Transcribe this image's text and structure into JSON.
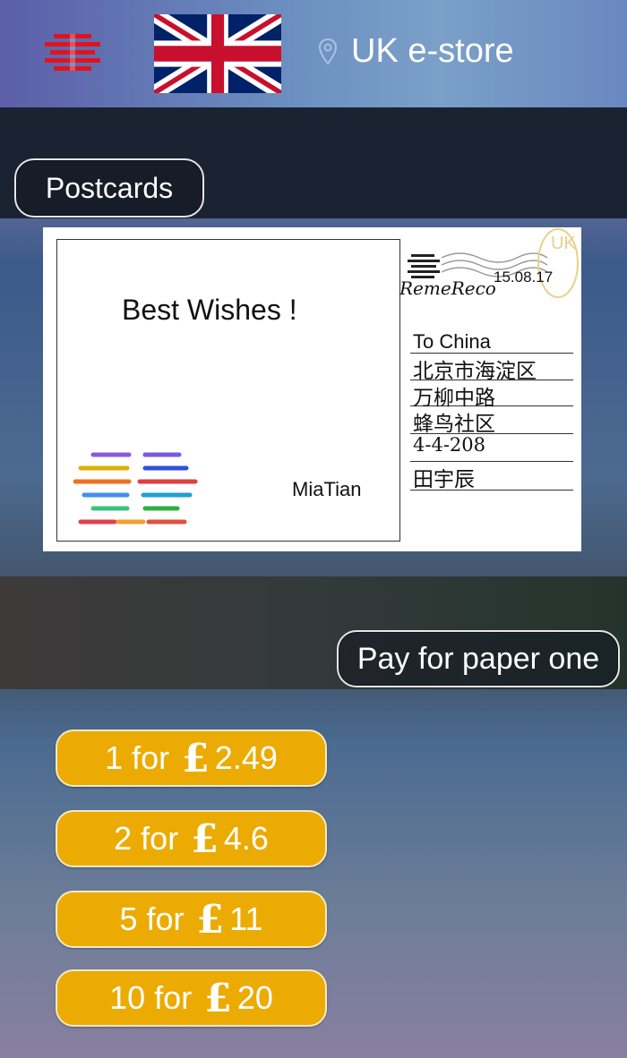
{
  "header": {
    "store_title": "UK e-store",
    "logo_icon": "remereco-logo-icon",
    "flag_icon": "uk-flag-icon",
    "location_icon": "location-pin-icon"
  },
  "category": {
    "label": "Postcards"
  },
  "postcard": {
    "greeting": "Best Wishes !",
    "signature": "MiaTian",
    "stamp_brand": "RemeReco",
    "stamp_date": "15.08.17",
    "stamp_country": "UK",
    "address_lines": [
      "To China",
      "北京市海淀区",
      "万柳中路",
      "蜂鸟社区",
      "4-4-208",
      "田宇辰"
    ]
  },
  "pay_button": {
    "label": "Pay for paper one"
  },
  "price_options": [
    {
      "quantity_text": "1 for",
      "currency": "£",
      "price": "2.49"
    },
    {
      "quantity_text": "2 for",
      "currency": "£",
      "price": "4.6"
    },
    {
      "quantity_text": "5 for",
      "currency": "£",
      "price": "11"
    },
    {
      "quantity_text": "10 for",
      "currency": "£",
      "price": "20"
    }
  ],
  "colors": {
    "accent": "#ecab03",
    "logo_red": "#e0141e",
    "dark_band": "#1b2333"
  }
}
